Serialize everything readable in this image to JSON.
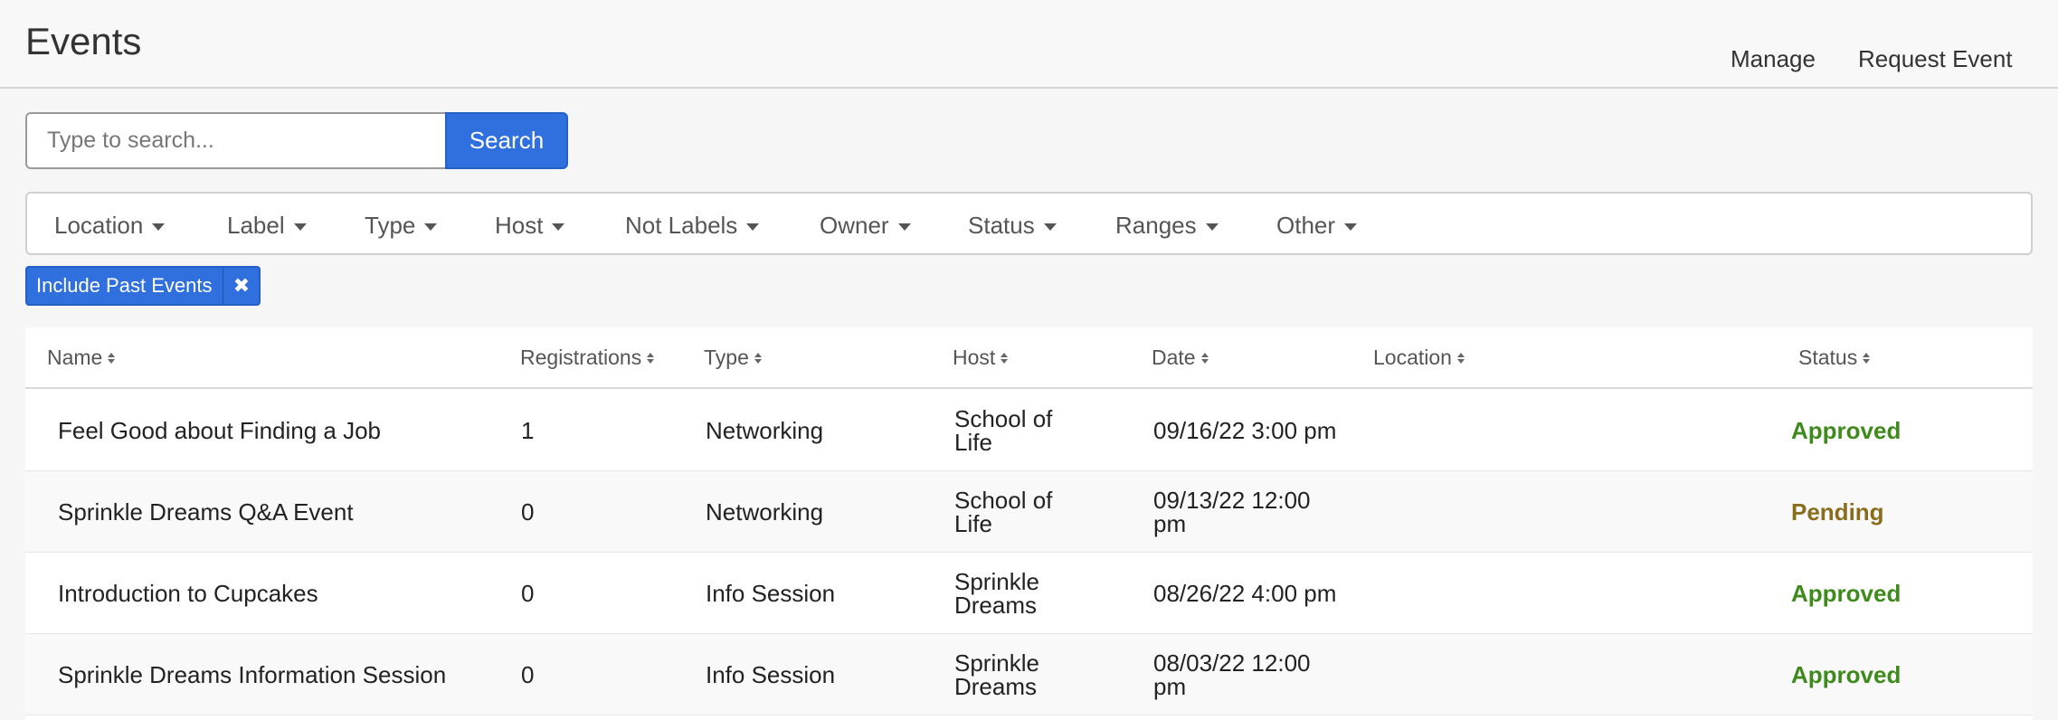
{
  "header": {
    "title": "Events",
    "links": {
      "manage": "Manage",
      "request": "Request Event"
    }
  },
  "search": {
    "placeholder": "Type to search...",
    "button_label": "Search"
  },
  "filters": [
    "Location",
    "Label",
    "Type",
    "Host",
    "Not Labels",
    "Owner",
    "Status",
    "Ranges",
    "Other"
  ],
  "active_filter": {
    "label": "Include Past Events",
    "close_icon": "times-icon"
  },
  "table": {
    "columns": {
      "name": "Name",
      "registrations": "Registrations",
      "type": "Type",
      "host": "Host",
      "date": "Date",
      "location": "Location",
      "status": "Status"
    },
    "rows": [
      {
        "name": "Feel Good about Finding a Job",
        "registrations": "1",
        "type": "Networking",
        "host": "School of Life",
        "date": "09/16/22 3:00 pm",
        "location": "",
        "status": "Approved"
      },
      {
        "name": "Sprinkle Dreams Q&A Event",
        "registrations": "0",
        "type": "Networking",
        "host": "School of Life",
        "date": "09/13/22 12:00 pm",
        "location": "",
        "status": "Pending"
      },
      {
        "name": "Introduction to Cupcakes",
        "registrations": "0",
        "type": "Info Session",
        "host": "Sprinkle Dreams",
        "date": "08/26/22 4:00 pm",
        "location": "",
        "status": "Approved"
      },
      {
        "name": "Sprinkle Dreams Information Session",
        "registrations": "0",
        "type": "Info Session",
        "host": "Sprinkle Dreams",
        "date": "08/03/22 12:00 pm",
        "location": "",
        "status": "Approved"
      }
    ]
  },
  "colors": {
    "accent": "#2f6fde",
    "approved": "#3f8a1c",
    "pending": "#8a6d1c"
  }
}
